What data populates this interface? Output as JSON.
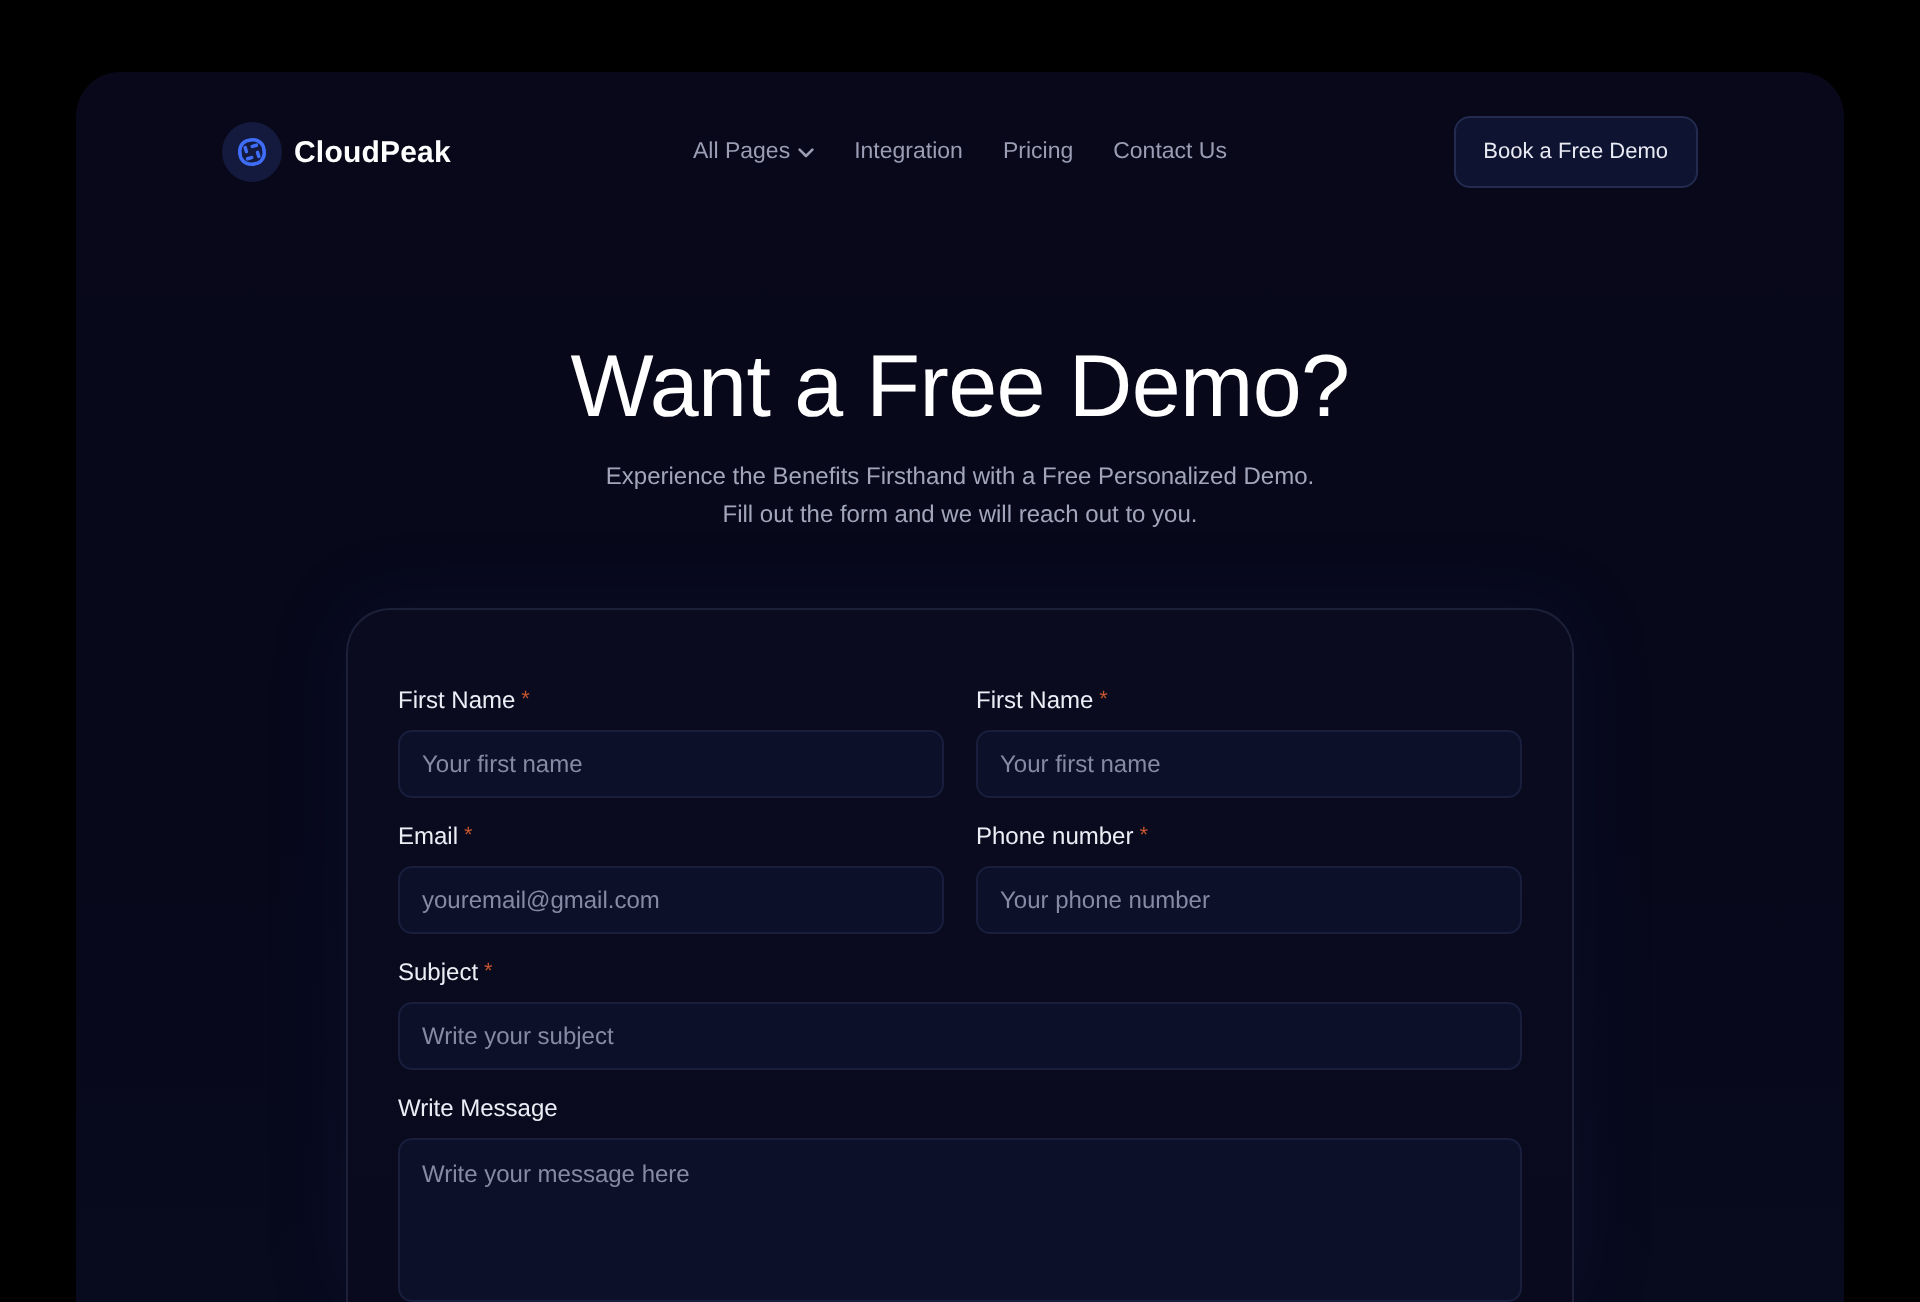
{
  "header": {
    "brand": "CloudPeak",
    "nav": [
      {
        "label": "All Pages",
        "kind": "dropdown"
      },
      {
        "label": "Integration",
        "kind": "link"
      },
      {
        "label": "Pricing",
        "kind": "link"
      },
      {
        "label": "Contact Us",
        "kind": "link"
      }
    ],
    "cta": "Book a Free Demo"
  },
  "hero": {
    "title": "Want a Free Demo?",
    "subtitle": [
      "Experience the Benefits Firsthand with a Free Personalized Demo.",
      "Fill out the form and we will reach out to you."
    ]
  },
  "form": {
    "rows": [
      [
        {
          "kind": "text",
          "label": "First Name",
          "required_mark": "*",
          "placeholder": "Your first name"
        },
        {
          "kind": "text",
          "label": "First Name",
          "required_mark": "*",
          "placeholder": "Your first name"
        }
      ],
      [
        {
          "kind": "text",
          "label": "Email",
          "required_mark": "*",
          "placeholder": "youremail@gmail.com"
        },
        {
          "kind": "text",
          "label": "Phone number",
          "required_mark": "*",
          "placeholder": "Your phone number"
        }
      ],
      [
        {
          "kind": "text",
          "label": "Subject",
          "required_mark": "*",
          "placeholder": "Write your subject"
        }
      ],
      [
        {
          "kind": "textarea",
          "label": "Write Message",
          "placeholder": "Write your message here"
        }
      ]
    ]
  }
}
